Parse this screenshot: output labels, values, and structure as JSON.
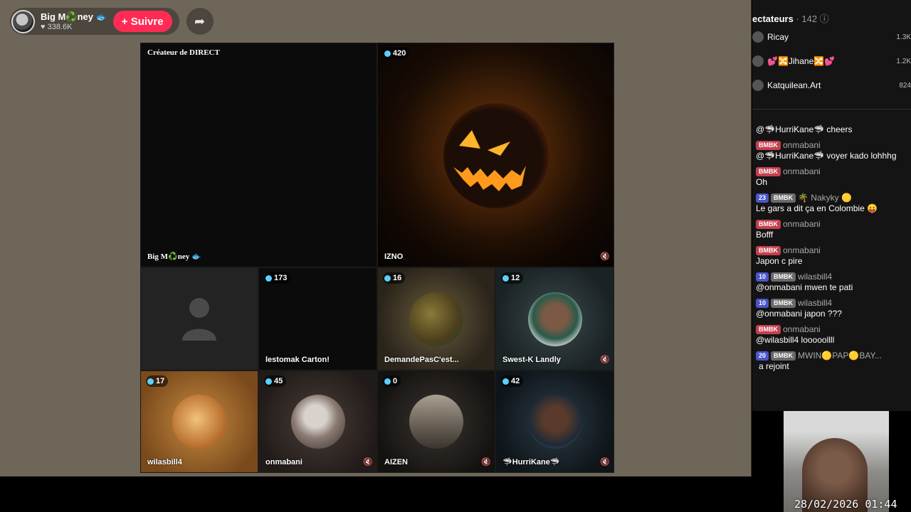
{
  "host": {
    "name": "Big M♻️ney 🐟",
    "likes": "♥ 338.6K",
    "follow_label": "+ Suivre",
    "share_icon": "share-icon"
  },
  "grid": {
    "creator_tag": "Créateur de DIRECT",
    "tiles": [
      {
        "label": "Big M♻️ney 🐟",
        "count": ""
      },
      {
        "label": "IZNO",
        "count": "420"
      },
      {
        "label": "",
        "count": ""
      },
      {
        "label": "lestomak Carton!",
        "count": "173"
      },
      {
        "label": "DemandePasC'est...",
        "count": "16"
      },
      {
        "label": "Swest-K Landly",
        "count": "12"
      },
      {
        "label": "wilasbill4",
        "count": "17"
      },
      {
        "label": "onmabani",
        "count": "45"
      },
      {
        "label": "AIZEN",
        "count": "0"
      },
      {
        "label": "🦈HurriKane🦈",
        "count": "42"
      }
    ]
  },
  "viewers": {
    "title": "ectateurs",
    "count": "· 142",
    "help_icon": "help-icon",
    "list": [
      {
        "name": "Ricay",
        "score": "1.3K"
      },
      {
        "name": "💕🔀Jihane🔀💕",
        "score": "1.2K"
      },
      {
        "name": "Katquilean.Art",
        "score": "824"
      }
    ]
  },
  "chat": [
    {
      "badges": [],
      "user": "",
      "text": "@🦈HurriKane🦈 cheers"
    },
    {
      "badges": [
        {
          "type": "fan",
          "text": "BMBK"
        }
      ],
      "user": "onmabani",
      "text": "@🦈HurriKane🦈 voyer kado lohhhg"
    },
    {
      "badges": [
        {
          "type": "fan",
          "text": "BMBK"
        }
      ],
      "user": "onmabani",
      "text": "Oh"
    },
    {
      "badges": [
        {
          "type": "level",
          "text": "23"
        },
        {
          "type": "gray",
          "text": "BMBK"
        }
      ],
      "user": "🌴 Nakyky 🟡",
      "text": "Le gars a dit ça en Colombie 😛"
    },
    {
      "badges": [
        {
          "type": "fan",
          "text": "BMBK"
        }
      ],
      "user": "onmabani",
      "text": "Bofff"
    },
    {
      "badges": [
        {
          "type": "fan",
          "text": "BMBK"
        }
      ],
      "user": "onmabani",
      "text": "Japon c pire"
    },
    {
      "badges": [
        {
          "type": "level",
          "text": "10"
        },
        {
          "type": "gray",
          "text": "BMBK"
        }
      ],
      "user": "wilasbill4",
      "text": "@onmabani mwen te pati"
    },
    {
      "badges": [
        {
          "type": "level",
          "text": "10"
        },
        {
          "type": "gray",
          "text": "BMBK"
        }
      ],
      "user": "wilasbill4",
      "text": "@onmabani japon ???"
    },
    {
      "badges": [
        {
          "type": "fan",
          "text": "BMBK"
        }
      ],
      "user": "onmabani",
      "text": "@wilasbill4 looooollll"
    },
    {
      "badges": [
        {
          "type": "level",
          "text": "20"
        },
        {
          "type": "gray",
          "text": "BMBK"
        }
      ],
      "user": "MWIN🟡PAP🟡BAY...",
      "text": "a rejoint"
    }
  ],
  "overlay": {
    "timestamp": "28/02/2026 01:44"
  },
  "colors": {
    "follow": "#fe2c55",
    "panel": "#6e6658",
    "chat_bg": "#141414"
  }
}
